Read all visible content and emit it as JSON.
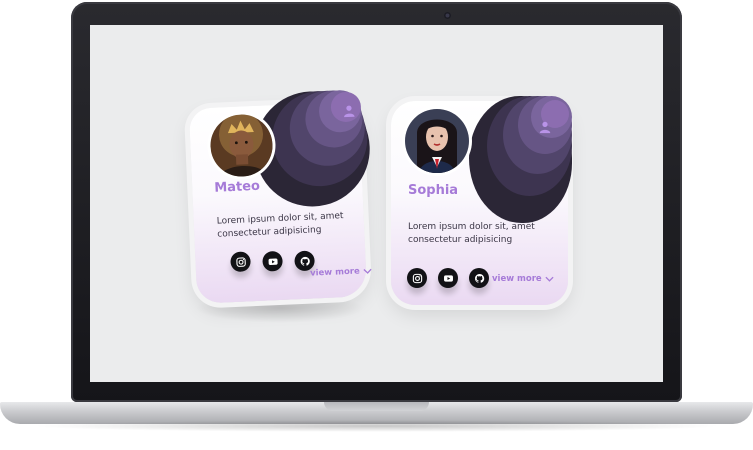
{
  "colors": {
    "accent": "#a67bd8",
    "ring_dark": "#2b2636",
    "ring_light": "#8c6db0",
    "screen_bg": "#ebeced"
  },
  "profiles": [
    {
      "name": "Mateo",
      "description": "Lorem ipsum dolor sit, amet consectetur adipisicing",
      "view_more": "view more",
      "social": [
        "instagram-icon",
        "youtube-icon",
        "github-icon"
      ],
      "top_icon": "user-icon"
    },
    {
      "name": "Sophia",
      "description": "Lorem ipsum dolor sit, amet consectetur adipisicing",
      "view_more": "view more",
      "social": [
        "instagram-icon",
        "youtube-icon",
        "github-icon"
      ],
      "top_icon": "user-icon"
    }
  ]
}
